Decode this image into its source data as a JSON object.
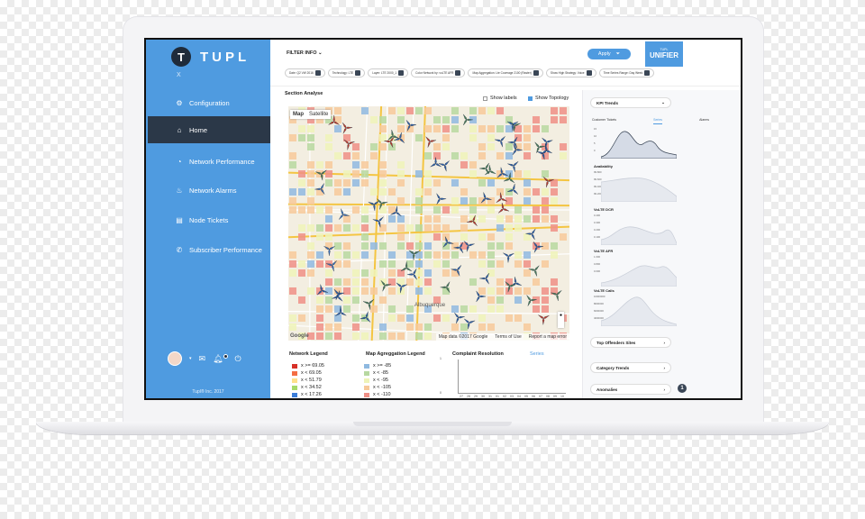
{
  "app": {
    "logo_text": "TUPL",
    "logo_mark": "T",
    "close_label": "X",
    "copyright": "Tupl® Inc. 2017"
  },
  "sidebar": {
    "items": [
      {
        "label": "Configuration",
        "icon": "gear-icon",
        "active": false
      },
      {
        "label": "Home",
        "icon": "home-icon",
        "active": true
      },
      {
        "label": "Network Performance",
        "icon": "gauge-icon",
        "active": false
      },
      {
        "label": "Network Alarms",
        "icon": "alarm-icon",
        "active": false
      },
      {
        "label": "Node Tickets",
        "icon": "clipboard-icon",
        "active": false
      },
      {
        "label": "Subscriber Performance",
        "icon": "phone-icon",
        "active": false
      }
    ]
  },
  "header": {
    "filter_info": "FILTER INFO",
    "apply_label": "Apply",
    "unifier_small": "TUPL",
    "unifier_label": "UNIFIER",
    "filters": [
      "Date: Q2 VW 2016",
      "Technology: LTE",
      "Layer: LTE 2000_1",
      "Color Network by: voLTE AFR",
      "Map Aggregation: Lte Coverage 2100 (Raster)",
      "Show High Strategy: Voice",
      "Time Series Range: Day Week"
    ]
  },
  "main": {
    "section_title": "Section Analyse",
    "show_labels": "Show labels",
    "show_topology": "Show Topology",
    "map_tabs": [
      "Map",
      "Satellite"
    ],
    "map_footer": [
      "Map data ©2017 Google",
      "Terms of Use",
      "Report a map error"
    ],
    "google_logo": "Google",
    "city_label": "Albuquerque"
  },
  "network_legend": {
    "title": "Network Legend",
    "items": [
      {
        "label": "x >= 69.05",
        "color": "#d73027"
      },
      {
        "label": "x < 69.05",
        "color": "#f46d43"
      },
      {
        "label": "x < 51.79",
        "color": "#fee08b"
      },
      {
        "label": "x < 34.52",
        "color": "#a6d96a"
      },
      {
        "label": "x < 17.26",
        "color": "#3b7dd8"
      }
    ]
  },
  "aggregation_legend": {
    "title": "Map Agreggation Legend",
    "items": [
      {
        "label": "x >= -85",
        "color": "#8fb9e0"
      },
      {
        "label": "x < -85",
        "color": "#b7d8a0"
      },
      {
        "label": "x < -95",
        "color": "#eef3b8"
      },
      {
        "label": "x < -105",
        "color": "#f7c99a"
      },
      {
        "label": "x < -110",
        "color": "#ef8f86"
      }
    ]
  },
  "complaint": {
    "title": "Complaint Resolution",
    "series_link": "Series",
    "y_ticks": [
      "1",
      "0"
    ],
    "x_ticks": [
      "27",
      "28",
      "29",
      "30",
      "31",
      "01",
      "02",
      "03",
      "04",
      "05",
      "06",
      "07",
      "08",
      "09",
      "10"
    ]
  },
  "right_panel": {
    "kpi_dropdown": "KPI Trends",
    "kpi_tabs": [
      "Customer Tickets",
      "Series",
      "Alarms"
    ],
    "charts": [
      {
        "title": "",
        "ticks": [
          "15",
          "10",
          "5",
          "0"
        ]
      },
      {
        "title": "Availability",
        "ticks": [
          "99.800",
          "99.600",
          "99.400",
          "99.200"
        ]
      },
      {
        "title": "VoLTE DCR",
        "ticks": [
          "0.400",
          "0.300",
          "0.200",
          "0.100"
        ]
      },
      {
        "title": "VoLTE AFR",
        "ticks": [
          "1.000",
          "0.800",
          "0.600"
        ]
      },
      {
        "title": "VoLTE Calls",
        "ticks": [
          "10000000",
          "8000000",
          "6000000",
          "4000000"
        ]
      }
    ],
    "pills": [
      "Top Offenders Sites",
      "Category Trends",
      "Anomalies"
    ],
    "anomaly_badge": "1"
  },
  "colors": {
    "accent": "#4f9be0",
    "sidebar_active": "#2b3848"
  }
}
